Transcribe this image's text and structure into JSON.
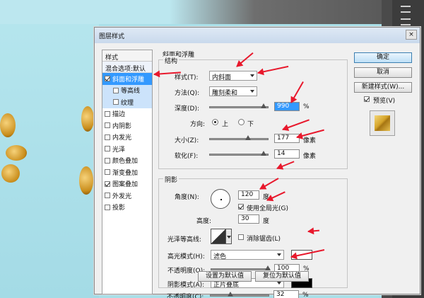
{
  "dialog": {
    "title": "图层样式",
    "close_glyph": "×"
  },
  "styles_list": {
    "header": "样式",
    "blend_options": "混合选项:默认",
    "items": [
      {
        "label": "斜面和浮雕",
        "checked": true,
        "selected": true
      },
      {
        "label": "等高线",
        "checked": false,
        "sub": true
      },
      {
        "label": "纹理",
        "checked": false,
        "sub": true
      },
      {
        "label": "描边",
        "checked": false
      },
      {
        "label": "内阴影",
        "checked": false
      },
      {
        "label": "内发光",
        "checked": false
      },
      {
        "label": "光泽",
        "checked": false
      },
      {
        "label": "颜色叠加",
        "checked": false
      },
      {
        "label": "渐变叠加",
        "checked": false
      },
      {
        "label": "图案叠加",
        "checked": true
      },
      {
        "label": "外发光",
        "checked": false
      },
      {
        "label": "投影",
        "checked": false
      }
    ]
  },
  "bevel": {
    "section_title": "斜面和浮雕",
    "structure_title": "结构",
    "style_label": "样式(T):",
    "style_value": "内斜面",
    "technique_label": "方法(Q):",
    "technique_value": "雕刻柔和",
    "depth_label": "深度(D):",
    "depth_value": "990",
    "depth_unit": "%",
    "direction_label": "方向:",
    "direction_up": "上",
    "direction_down": "下",
    "size_label": "大小(Z):",
    "size_value": "177",
    "size_unit": "像素",
    "soften_label": "软化(F):",
    "soften_value": "14",
    "soften_unit": "像素"
  },
  "shading": {
    "title": "阴影",
    "angle_label": "角度(N):",
    "angle_value": "120",
    "angle_unit": "度",
    "global_light_label": "使用全局光(G)",
    "global_light_checked": true,
    "altitude_label": "高度:",
    "altitude_value": "30",
    "altitude_unit": "度",
    "gloss_contour_label": "光泽等高线:",
    "anti_alias_label": "消除锯齿(L)",
    "anti_alias_checked": false,
    "highlight_mode_label": "高光模式(H):",
    "highlight_mode_value": "滤色",
    "highlight_color": "#ffffff",
    "highlight_opacity_label": "不透明度(O):",
    "highlight_opacity_value": "100",
    "highlight_opacity_unit": "%",
    "shadow_mode_label": "阴影模式(A):",
    "shadow_mode_value": "正片叠底",
    "shadow_color": "#000000",
    "shadow_opacity_label": "不透明度(C):",
    "shadow_opacity_value": "32",
    "shadow_opacity_unit": "%"
  },
  "footer": {
    "set_default": "设置为默认值",
    "reset_default": "复位为默认值"
  },
  "buttons": {
    "ok": "确定",
    "cancel": "取消",
    "new_style": "新建样式(W)...",
    "preview_label": "预览(V)",
    "preview_checked": true
  },
  "colors": {
    "annotation_red": "#e8182c",
    "selection_blue": "#3399ff",
    "canvas_cyan": "#a9dfe8"
  }
}
